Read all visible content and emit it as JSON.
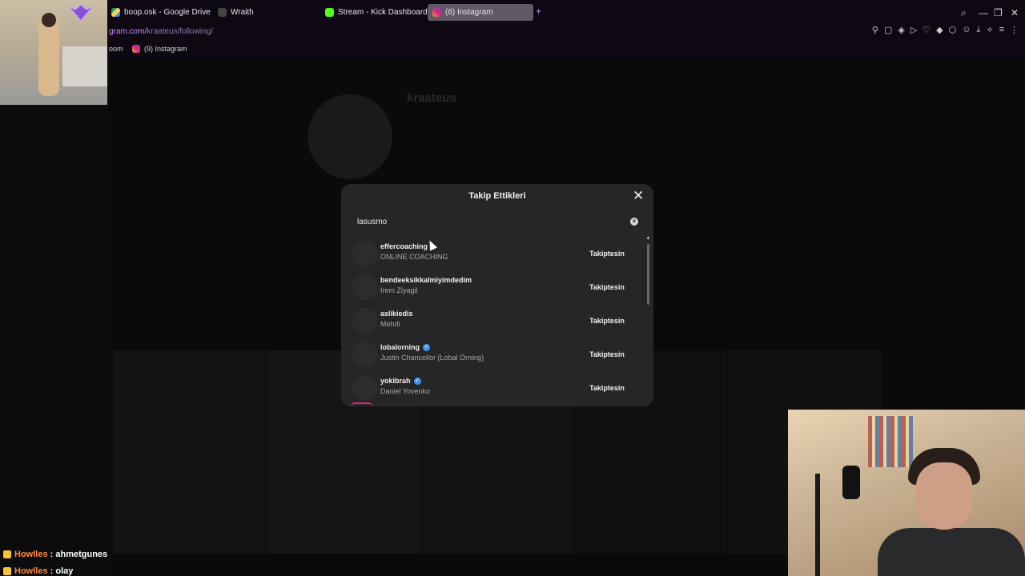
{
  "browser": {
    "tabs": [
      {
        "label": "boop.osk - Google Drive",
        "icon": "google-drive-icon"
      },
      {
        "label": "Wraith",
        "icon": "wraith-icon"
      },
      {
        "label": "Stream - Kick Dashboard",
        "icon": "kick-icon"
      },
      {
        "label": "(6) Instagram",
        "icon": "instagram-icon",
        "active": true
      }
    ],
    "new_tab": "+",
    "url_prefix": "gram.com/",
    "url_path": "kraateus/following/",
    "bookmarks": [
      {
        "label": "oom"
      },
      {
        "label": "(9) Instagram"
      }
    ]
  },
  "profile_bg": {
    "username": "kraateus"
  },
  "modal": {
    "title": "Takip Ettikleri",
    "close": "✕",
    "search_value": "lasusmo",
    "clear": "×",
    "accounts": [
      {
        "username": "effercoaching",
        "full_name": "ONLINE COACHING",
        "verified": false,
        "button": "Takiptesin"
      },
      {
        "username": "bendeeksikkalmiyimdedim",
        "full_name": "Irem Ziyagil",
        "verified": false,
        "button": "Takiptesin"
      },
      {
        "username": "aslikiedis",
        "full_name": "Mehdi",
        "verified": false,
        "button": "Takiptesin"
      },
      {
        "username": "lobalorning",
        "full_name": "Justin Chancellor (Lobal Orning)",
        "verified": true,
        "button": "Takiptesin"
      },
      {
        "username": "yokibrah",
        "full_name": "Daniel Yovenko",
        "verified": true,
        "button": "Takiptesin"
      }
    ]
  },
  "chat": [
    {
      "user": "Howlles",
      "message": "ahmetgunes"
    },
    {
      "user": "Howlles",
      "message": "olay"
    }
  ],
  "colors": {
    "modal_bg": "#262626",
    "verified": "#3897f0",
    "chat_user": "#ff8a3a",
    "accent_url": "#c98cff"
  }
}
